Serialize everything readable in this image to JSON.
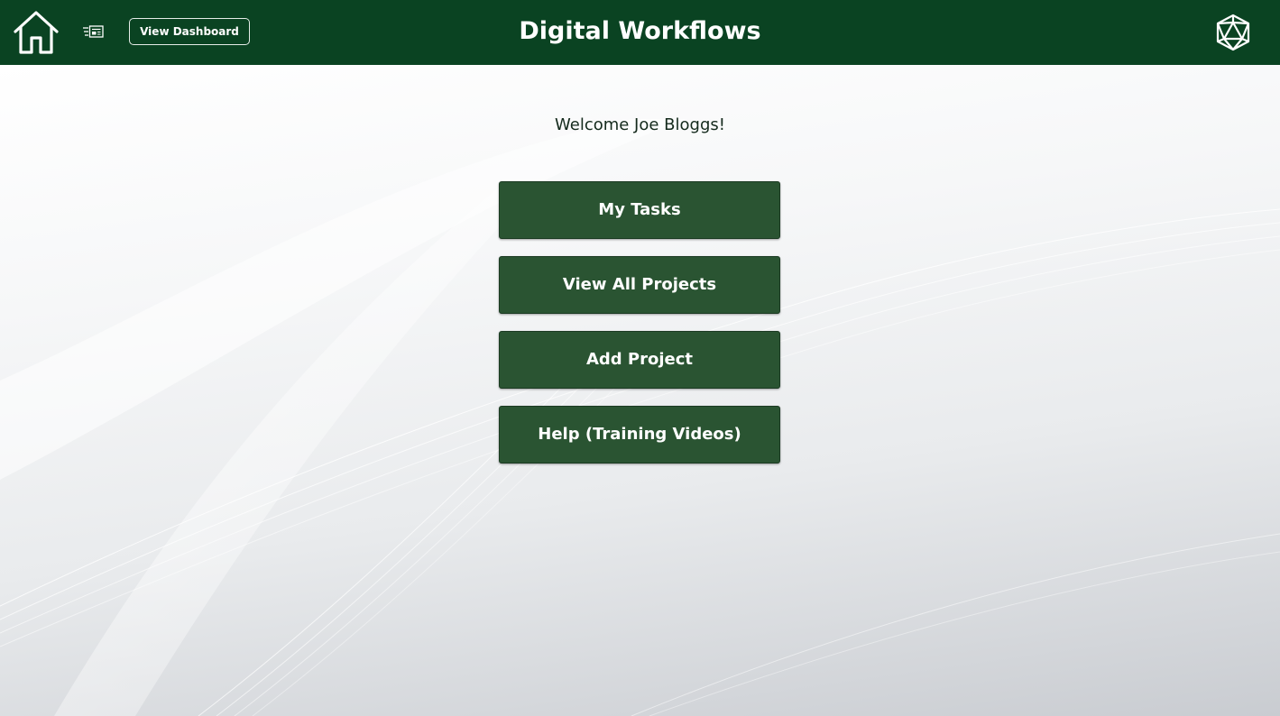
{
  "header": {
    "title": "Digital Workflows",
    "dashboard_button_label": "View Dashboard",
    "background_color": "#0a4322"
  },
  "icons": {
    "home": "home-icon",
    "news": "newspaper-icon",
    "logo": "polyhedron-logo-icon"
  },
  "main": {
    "welcome_text": "Welcome Joe Bloggs!",
    "buttons": [
      {
        "label": "My Tasks"
      },
      {
        "label": "View All Projects"
      },
      {
        "label": "Add Project"
      },
      {
        "label": "Help (Training Videos)"
      }
    ],
    "button_color": "#2a5432"
  }
}
